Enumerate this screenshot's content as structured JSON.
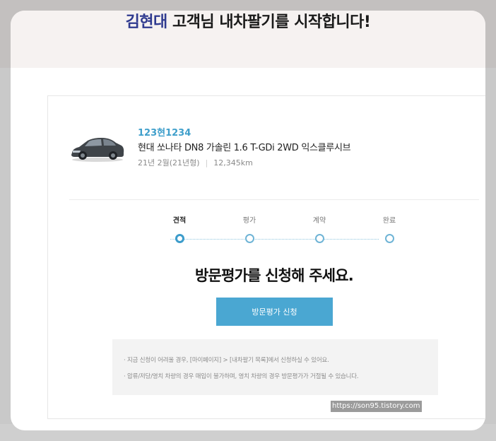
{
  "hero": {
    "customer_name": "김현대",
    "title_rest": " 고객님 내차팔기를 시작합니다!"
  },
  "vehicle": {
    "plate": "123현1234",
    "model": "현대 쏘나타 DN8 가솔린 1.6 T-GDi 2WD 익스클루시브",
    "year": "21년 2월(21년형)",
    "mileage": "12,345km"
  },
  "steps": [
    {
      "label": "견적",
      "active": true
    },
    {
      "label": "평가",
      "active": false
    },
    {
      "label": "계약",
      "active": false
    },
    {
      "label": "완료",
      "active": false
    }
  ],
  "headline": "방문평가를 신청해 주세요.",
  "apply_button": "방문평가 신청",
  "notices": [
    "· 지금 신청이 어려울 경우, [마이페이지] > [내차팔기 목록]에서 신청하실 수 있어요.",
    "· 압류/저당/영치 차량의 경우 매입이 불가하며, 영치 차량의 경우 방문평가가 거절될 수 있습니다."
  ],
  "watermark": "https://son95.tistory.com",
  "colors": {
    "accent": "#4aa7d2",
    "plate": "#3f9fcb",
    "name": "#2f3a8f"
  },
  "icons": {
    "car": "car-image-icon"
  }
}
